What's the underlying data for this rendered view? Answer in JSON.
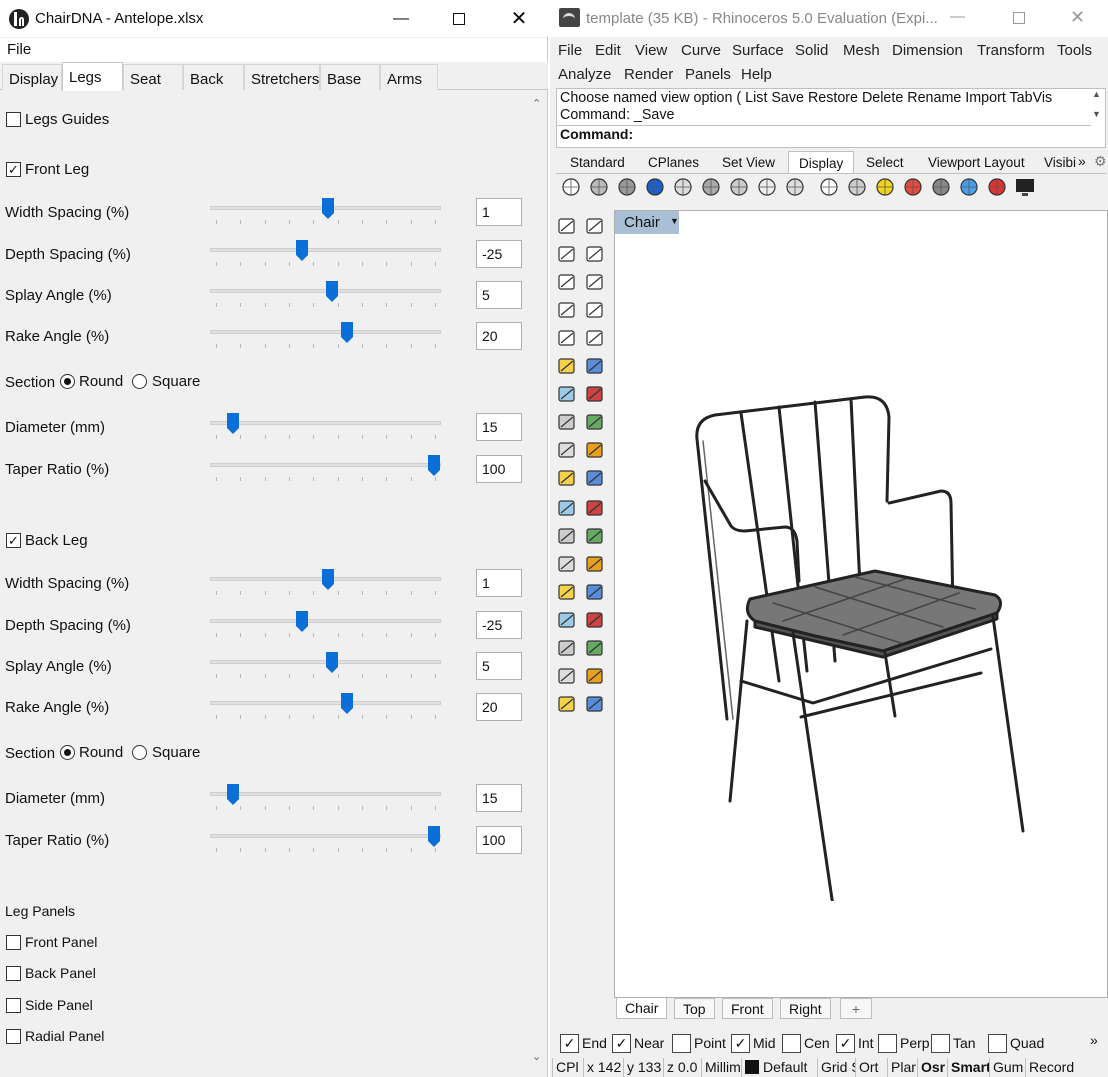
{
  "left": {
    "title": "ChairDNA - Antelope.xlsx",
    "menu": {
      "file": "File"
    },
    "tabs": [
      "Display",
      "Legs",
      "Seat",
      "Back",
      "Stretchers",
      "Base",
      "Arms"
    ],
    "legs_guides": "Legs Guides",
    "front": {
      "header": "Front Leg",
      "rows": [
        {
          "label": "Width Spacing (%)",
          "value": "1",
          "fill": 0.5
        },
        {
          "label": "Depth Spacing (%)",
          "value": "-25",
          "fill": 0.375
        },
        {
          "label": "Splay Angle (%)",
          "value": "5",
          "fill": 0.52
        },
        {
          "label": "Rake Angle (%)",
          "value": "20",
          "fill": 0.59
        },
        {
          "label": "Diameter (mm)",
          "value": "15",
          "fill": 0.05
        },
        {
          "label": "Taper Ratio (%)",
          "value": "100",
          "fill": 1.0
        }
      ],
      "section": "Section",
      "round": "Round",
      "square": "Square"
    },
    "back": {
      "header": "Back Leg",
      "rows": [
        {
          "label": "Width Spacing (%)",
          "value": "1",
          "fill": 0.5
        },
        {
          "label": "Depth Spacing (%)",
          "value": "-25",
          "fill": 0.375
        },
        {
          "label": "Splay Angle (%)",
          "value": "5",
          "fill": 0.52
        },
        {
          "label": "Rake Angle (%)",
          "value": "20",
          "fill": 0.59
        },
        {
          "label": "Diameter (mm)",
          "value": "15",
          "fill": 0.05
        },
        {
          "label": "Taper Ratio (%)",
          "value": "100",
          "fill": 1.0
        }
      ],
      "section": "Section",
      "round": "Round",
      "square": "Square"
    },
    "panels": {
      "header": "Leg Panels",
      "items": [
        "Front Panel",
        "Back Panel",
        "Side Panel",
        "Radial Panel"
      ]
    }
  },
  "right": {
    "title": "template (35 KB) - Rhinoceros 5.0 Evaluation (Expi...",
    "menu1": [
      "File",
      "Edit",
      "View",
      "Curve",
      "Surface",
      "Solid",
      "Mesh",
      "Dimension",
      "Transform",
      "Tools"
    ],
    "menu2": [
      "Analyze",
      "Render",
      "Panels",
      "Help"
    ],
    "cmd_line1": "Choose named view option ( List  Save  Restore  Delete  Rename  Import  TabVis",
    "cmd_line2": "Command: _Save",
    "cmd_prompt": "Command:",
    "toolbar_tabs": [
      "Standard",
      "CPlanes",
      "Set View",
      "Display",
      "Select",
      "Viewport Layout",
      "Visibi"
    ],
    "more": "»",
    "viewport_title": "Chair",
    "viewport_tabs": [
      "Chair",
      "Top",
      "Front",
      "Right"
    ],
    "add_tab": "+",
    "snaps": [
      {
        "label": "End",
        "on": "✓"
      },
      {
        "label": "Near",
        "on": "✓"
      },
      {
        "label": "Point",
        "on": ""
      },
      {
        "label": "Mid",
        "on": "✓"
      },
      {
        "label": "Cen",
        "on": ""
      },
      {
        "label": "Int",
        "on": "✓"
      },
      {
        "label": "Perp",
        "on": ""
      },
      {
        "label": "Tan",
        "on": ""
      },
      {
        "label": "Quad",
        "on": ""
      }
    ],
    "status": [
      "CPl",
      "x 142",
      "y 133",
      "z 0.0",
      "Millim",
      "Default",
      "Grid S",
      "Ort",
      "Plar",
      "Osr",
      "Smart",
      "Gum",
      "Record"
    ],
    "colors": {
      "accent": "#0a6fd6",
      "viewport_title_bg": "#a9bfd6"
    }
  }
}
